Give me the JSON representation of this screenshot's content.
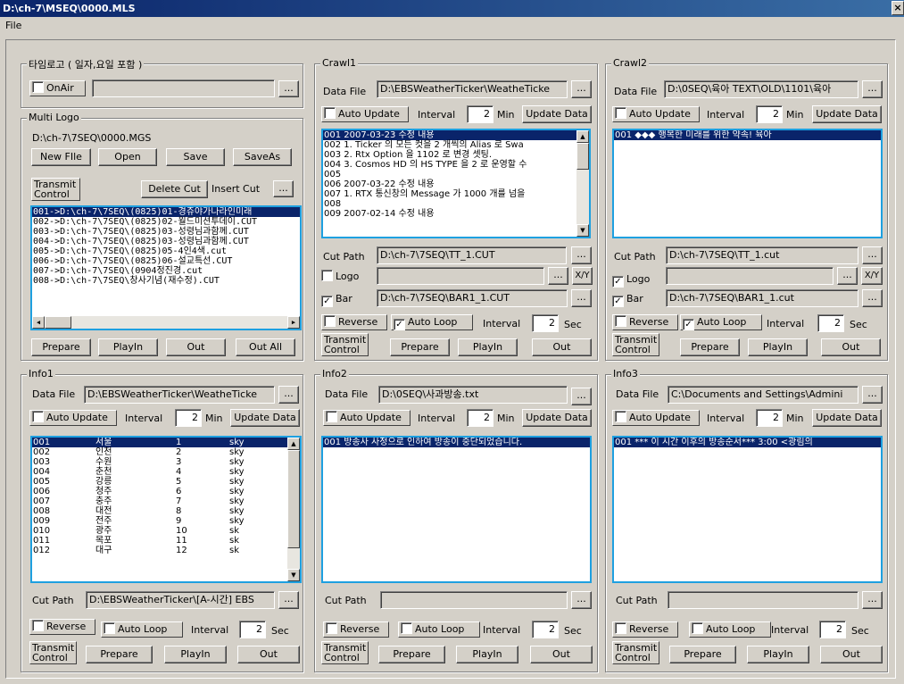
{
  "window": {
    "title": "D:\\ch-7\\MSEQ\\0000.MLS",
    "close_glyph": "×"
  },
  "menu": {
    "file": "File"
  },
  "common": {
    "browse": "...",
    "xy": "X/Y",
    "transmit_control": "Transmit Control",
    "prepare": "Prepare",
    "playin": "PlayIn",
    "out": "Out",
    "min": "Min",
    "sec": "Sec",
    "interval": "Interval",
    "auto_update": "Auto Update",
    "update_data": "Update Data",
    "data_file": "Data File",
    "cut_path": "Cut Path",
    "reverse": "Reverse",
    "auto_loop": "Auto Loop",
    "logo": "Logo",
    "bar": "Bar"
  },
  "timelogo": {
    "title": "타임로고 ( 일자,요일 포함 )",
    "onair": "OnAir",
    "value": ""
  },
  "multilogo": {
    "title": "Multi Logo",
    "path": "D:\\ch-7\\7SEQ\\0000.MGS",
    "new_file": "New FIle",
    "open": "Open",
    "save": "Save",
    "save_as": "SaveAs",
    "delete_cut": "Delete Cut",
    "insert_cut": "Insert Cut",
    "out_all": "Out All",
    "items": [
      "001->D:\\ch-7\\7SEQ\\(0825)01-경쥬야가나라인미래",
      "002->D:\\ch-7\\7SEQ\\(0825)02-월드미션투데이.CUT",
      "003->D:\\ch-7\\7SEQ\\(0825)03-성령님과함께.CUT",
      "004->D:\\ch-7\\7SEQ\\(0825)03-성령님과함께.CUT",
      "005->D:\\ch-7\\7SEQ\\(0825)05-4인4색.cut",
      "006->D:\\ch-7\\7SEQ\\(0825)06-설교특선.CUT",
      "007->D:\\ch-7\\7SEQ\\(0904정진경.cut",
      "008->D:\\ch-7\\7SEQ\\창사기념(재수정).CUT"
    ]
  },
  "crawl1": {
    "title": "Crawl1",
    "data_file": "D:\\EBSWeatherTicker\\WeatheTicke",
    "interval": "2",
    "items": [
      "001 2007-03-23 수정 내용",
      "002 1. Ticker 의 모든 컷을 2 개씩의 Alias 로 Swa",
      "003 2. Rtx Option 을 1102 로 변경 셋팅.",
      "004 3. Cosmos HD 의 HS TYPE 을 2 로 운영할 수",
      "005",
      "006 2007-03-22 수정 내용",
      "007 1. RTX 통신창의 Message 가 1000 개를 넘을",
      "008",
      "009 2007-02-14 수정 내용"
    ],
    "cut_path": "D:\\ch-7\\7SEQ\\TT_1.CUT",
    "logo_path": "",
    "bar_path": "D:\\ch-7\\7SEQ\\BAR1_1.CUT",
    "loop_interval": "2"
  },
  "crawl2": {
    "title": "Crawl2",
    "data_file": "D:\\0SEQ\\육아 TEXT\\OLD\\1101\\육아",
    "interval": "2",
    "items": [
      "001 ◆◆◆      행복한 미래를 위한 약속!      육아"
    ],
    "cut_path": "D:\\ch-7\\7SEQ\\TT_1.cut",
    "logo_path": "",
    "bar_path": "D:\\ch-7\\7SEQ\\BAR1_1.cut",
    "loop_interval": "2"
  },
  "info1": {
    "title": "Info1",
    "data_file": "D:\\EBSWeatherTicker\\WeatheTicke",
    "interval": "2",
    "rows": [
      [
        "001",
        "서울",
        "1",
        "sky"
      ],
      [
        "002",
        "인천",
        "2",
        "sky"
      ],
      [
        "003",
        "수원",
        "3",
        "sky"
      ],
      [
        "004",
        "춘천",
        "4",
        "sky"
      ],
      [
        "005",
        "강릉",
        "5",
        "sky"
      ],
      [
        "006",
        "청주",
        "6",
        "sky"
      ],
      [
        "007",
        "충주",
        "7",
        "sky"
      ],
      [
        "008",
        "대전",
        "8",
        "sky"
      ],
      [
        "009",
        "전주",
        "9",
        "sky"
      ],
      [
        "010",
        "광주",
        "10",
        "sk"
      ],
      [
        "011",
        "목포",
        "11",
        "sk"
      ],
      [
        "012",
        "대구",
        "12",
        "sk"
      ]
    ],
    "cut_path": "D:\\EBSWeatherTicker\\[A-시간] EBS",
    "loop_interval": "2"
  },
  "info2": {
    "title": "Info2",
    "data_file": "D:\\0SEQ\\사과방송.txt",
    "interval": "2",
    "items": [
      "001 방송사 사정으로 인하여 방송이 중단되었습니다."
    ],
    "cut_path": "",
    "loop_interval": "2"
  },
  "info3": {
    "title": "Info3",
    "data_file": "C:\\Documents and Settings\\Admini",
    "interval": "2",
    "items": [
      "001 *** 이 시간 이후의 방송순서***   3:00 <광림의"
    ],
    "cut_path": "",
    "loop_interval": "2"
  }
}
